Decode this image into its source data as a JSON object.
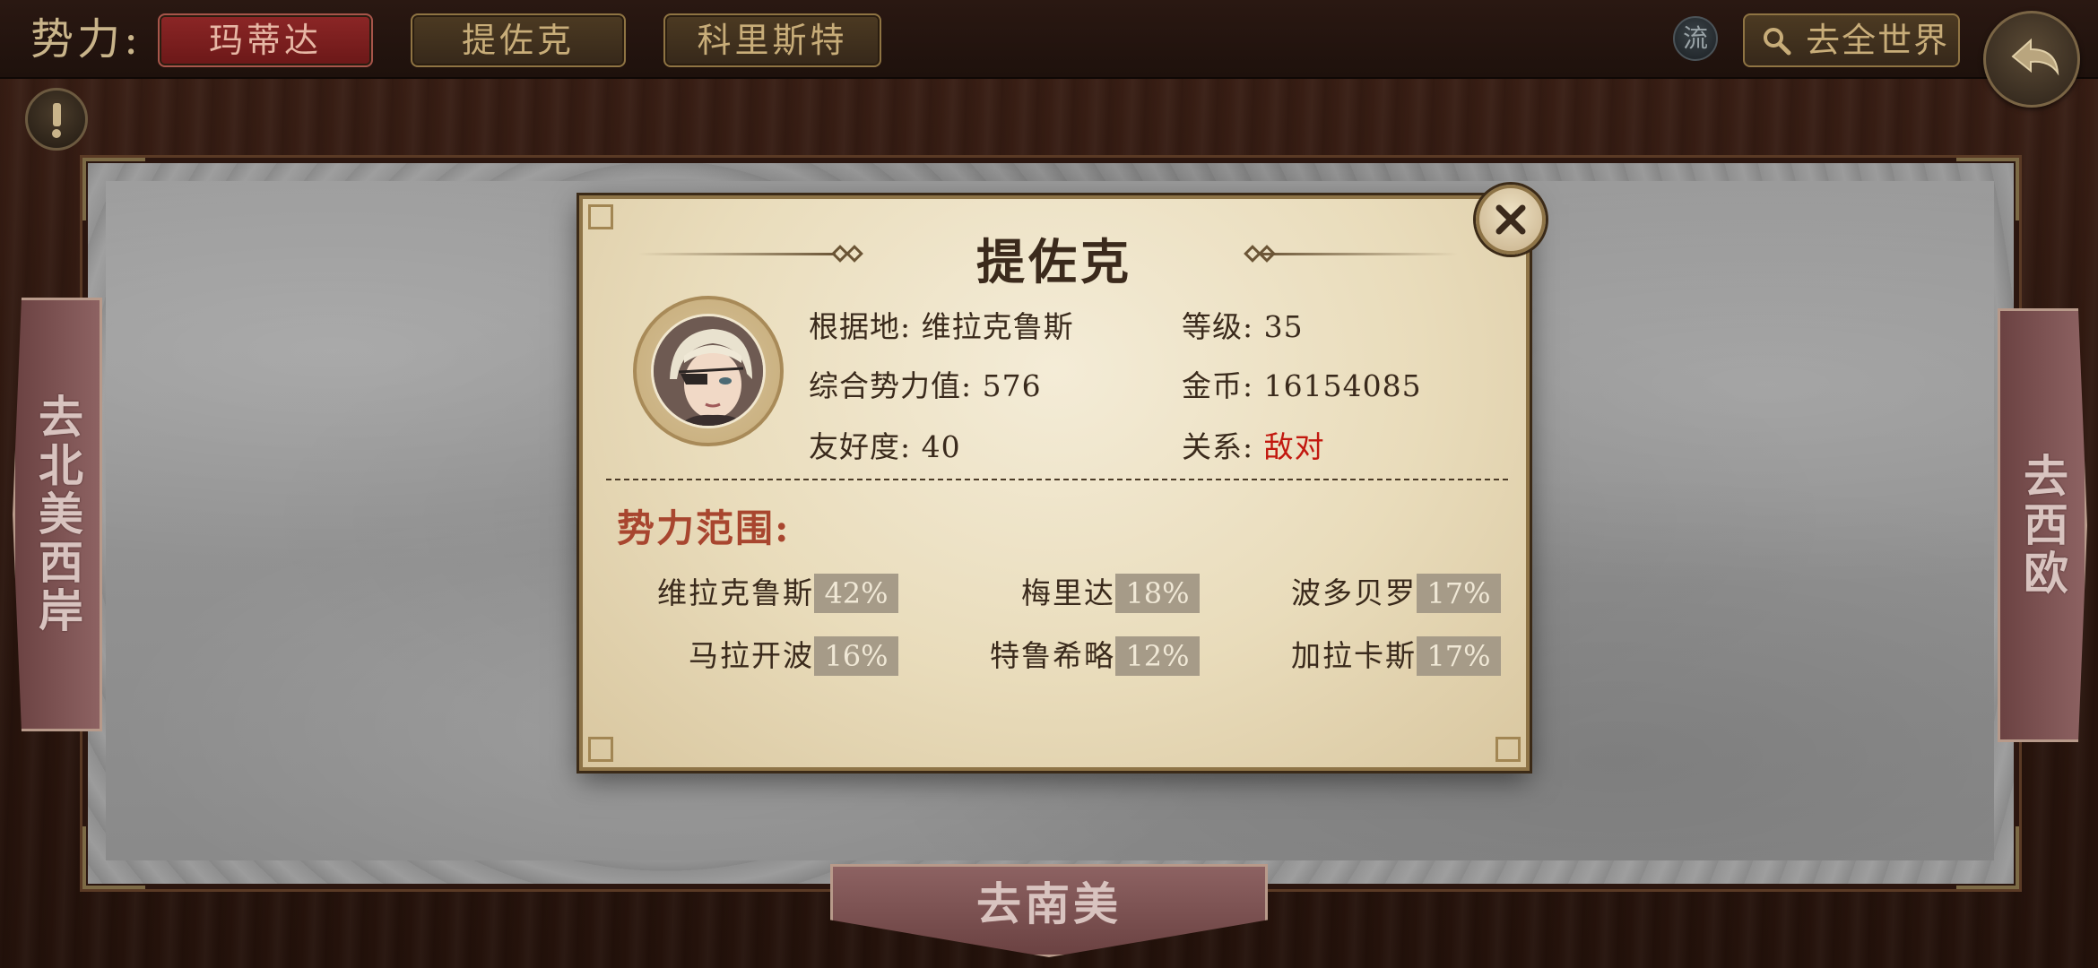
{
  "topbar": {
    "faction_label": "势力:",
    "tabs": [
      {
        "label": "玛蒂达",
        "active": true
      },
      {
        "label": "提佐克",
        "active": false
      },
      {
        "label": "科里斯特",
        "active": false
      }
    ],
    "flow_label": "流",
    "world_label": "去全世界"
  },
  "nav": {
    "left": "去北美西岸",
    "right": "去西欧",
    "bottom": "去南美"
  },
  "dialog": {
    "title": "提佐克",
    "base": {
      "key": "根据地:",
      "value": "维拉克鲁斯"
    },
    "level": {
      "key": "等级:",
      "value": "35"
    },
    "power": {
      "key": "综合势力值:",
      "value": "576"
    },
    "gold": {
      "key": "金币:",
      "value": "16154085"
    },
    "friendliness": {
      "key": "友好度:",
      "value": "40"
    },
    "relation": {
      "key": "关系:",
      "value": "敌对"
    },
    "range_title": "势力范围:",
    "ranges": [
      {
        "name": "维拉克鲁斯",
        "pct": "42%"
      },
      {
        "name": "梅里达",
        "pct": "18%"
      },
      {
        "name": "波多贝罗",
        "pct": "17%"
      },
      {
        "name": "马拉开波",
        "pct": "16%"
      },
      {
        "name": "特鲁希略",
        "pct": "12%"
      },
      {
        "name": "加拉卡斯",
        "pct": "17%"
      }
    ]
  },
  "colors": {
    "hostile": "#c2180f",
    "active_tab": "#8c2626",
    "range_title": "#a8462f"
  },
  "icons": [
    "search-icon",
    "back-arrow-icon",
    "close-icon",
    "alert-icon",
    "avatar-portrait"
  ]
}
